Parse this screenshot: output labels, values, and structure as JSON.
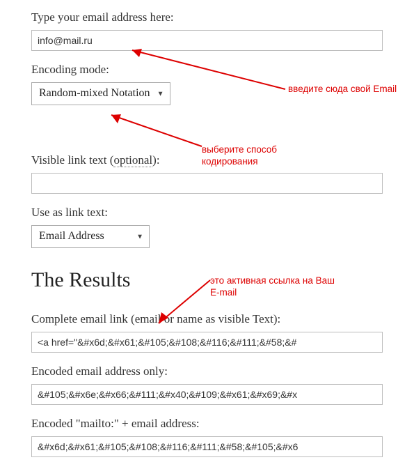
{
  "form": {
    "email_label": "Type your email address here:",
    "email_value": "info@mail.ru",
    "encoding_label": "Encoding mode:",
    "encoding_value": "Random-mixed Notation",
    "visible_label_pre": "Visible link text (",
    "visible_label_opt": "optional",
    "visible_label_post": "):",
    "visible_value": "",
    "useas_label": "Use as link text:",
    "useas_value": "Email Address"
  },
  "results": {
    "heading": "The Results",
    "complete_label": "Complete email link (email or name as visible Text):",
    "complete_value": "<a href=\"&#x6d;&#x61;&#105;&#108;&#116;&#111;&#58;&#",
    "encoded_only_label": "Encoded email address only:",
    "encoded_only_value": "&#105;&#x6e;&#x66;&#111;&#x40;&#109;&#x61;&#x69;&#x",
    "mailto_label": "Encoded \"mailto:\" + email address:",
    "mailto_value": "&#x6d;&#x61;&#105;&#108;&#116;&#111;&#58;&#105;&#x6"
  },
  "annotations": {
    "a1": "введите сюда свой Email",
    "a2": "выберите способ кодирования",
    "a3": "это активная ссылка на Ваш E-mail"
  },
  "colors": {
    "annotation": "#d00",
    "border": "#bbb"
  }
}
